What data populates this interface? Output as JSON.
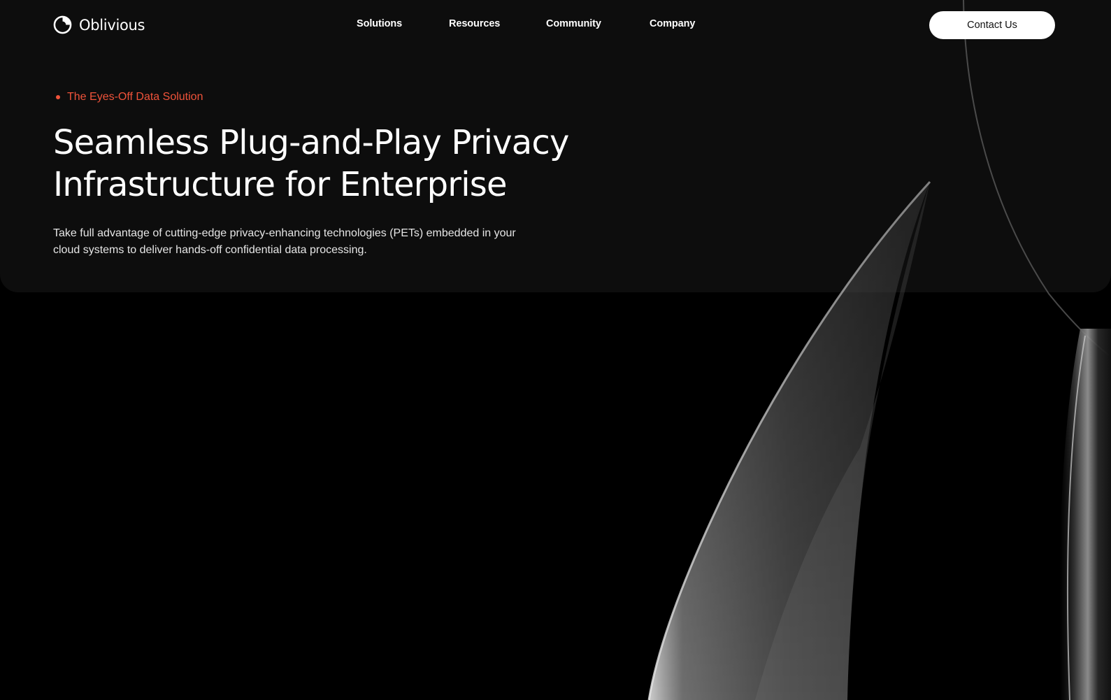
{
  "brand": {
    "name": "Oblivious",
    "logo_icon": "oblivious-logo-icon"
  },
  "nav": {
    "items": [
      {
        "label": "Solutions"
      },
      {
        "label": "Resources"
      },
      {
        "label": "Community"
      },
      {
        "label": "Company"
      }
    ],
    "contact_label": "Contact Us"
  },
  "hero": {
    "eyebrow": "The Eyes-Off Data Solution",
    "headline_line1": "Seamless Plug-and-Play Privacy",
    "headline_line2": "Infrastructure for Enterprise",
    "description": "Take full advantage of cutting-edge privacy-enhancing technologies (PETs) embedded in your cloud systems to deliver hands-off confidential data processing."
  },
  "colors": {
    "background": "#000000",
    "hero_panel": "#0d0d0d",
    "accent": "#f0533a",
    "text": "#ffffff",
    "button_bg": "#ffffff",
    "button_text": "#111111"
  }
}
